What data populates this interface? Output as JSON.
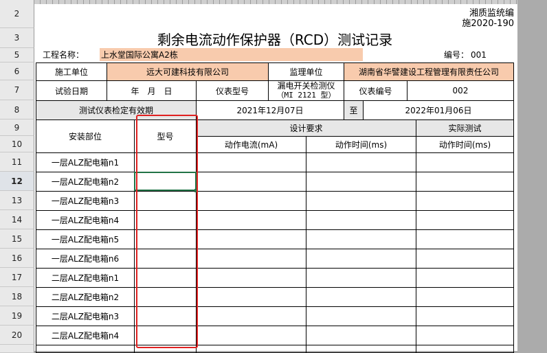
{
  "row_headers": [
    "2",
    "3",
    "5",
    "6",
    "7",
    "8",
    "9",
    "10",
    "11",
    "12",
    "13",
    "14",
    "15",
    "16",
    "17",
    "18",
    "19",
    "20"
  ],
  "selected_row": "12",
  "header": {
    "org_line": "湘质监统编",
    "code_line": "施2020-190",
    "title": "剩余电流动作保护器（RCD）测试记录",
    "project_label": "工程名称：",
    "project_value": "上水堂国际公寓A2栋",
    "number_label": "编号：",
    "number_value": "001"
  },
  "info": {
    "construction_unit_label": "施工单位",
    "construction_unit_value": "远大可建科技有限公司",
    "supervision_unit_label": "监理单位",
    "supervision_unit_value": "湖南省华譬建设工程管理有限责任公司",
    "test_date_label": "试验日期",
    "test_date_value": "年　月　日",
    "instrument_model_label": "仪表型号",
    "instrument_model_value_line1": "漏电开关检测仪",
    "instrument_model_value_line2": "（MI 2121 型）",
    "instrument_number_label": "仪表编号",
    "instrument_number_value": "002",
    "validity_label": "测试仪表检定有效期",
    "validity_from": "2021年12月07日",
    "validity_to_label": "至",
    "validity_to": "2022年01月06日"
  },
  "table": {
    "col_location": "安装部位",
    "col_model": "型号",
    "group_design": "设计要求",
    "group_actual": "实际测试",
    "col_current": "动作电流(mA)",
    "col_time_design": "动作时间(ms)",
    "col_time_actual": "动作时间(ms)",
    "rows": [
      "一层ALZ配电箱n1",
      "一层ALZ配电箱n2",
      "一层ALZ配电箱n3",
      "一层ALZ配电箱n4",
      "一层ALZ配电箱n5",
      "一层ALZ配电箱n6",
      "二层ALZ配电箱n1",
      "二层ALZ配电箱n2",
      "二层ALZ配电箱n3",
      "二层ALZ配电箱n4"
    ]
  }
}
